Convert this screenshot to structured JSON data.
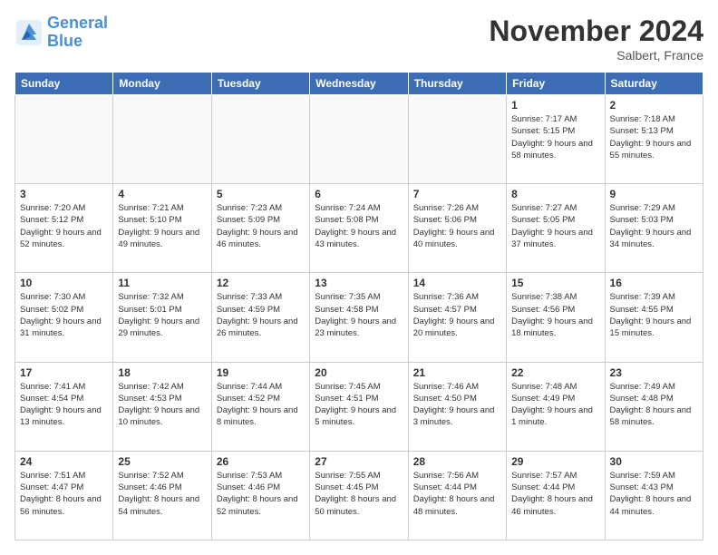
{
  "logo": {
    "line1": "General",
    "line2": "Blue"
  },
  "title": "November 2024",
  "location": "Salbert, France",
  "days_header": [
    "Sunday",
    "Monday",
    "Tuesday",
    "Wednesday",
    "Thursday",
    "Friday",
    "Saturday"
  ],
  "weeks": [
    [
      {
        "day": "",
        "info": ""
      },
      {
        "day": "",
        "info": ""
      },
      {
        "day": "",
        "info": ""
      },
      {
        "day": "",
        "info": ""
      },
      {
        "day": "",
        "info": ""
      },
      {
        "day": "1",
        "info": "Sunrise: 7:17 AM\nSunset: 5:15 PM\nDaylight: 9 hours and 58 minutes."
      },
      {
        "day": "2",
        "info": "Sunrise: 7:18 AM\nSunset: 5:13 PM\nDaylight: 9 hours and 55 minutes."
      }
    ],
    [
      {
        "day": "3",
        "info": "Sunrise: 7:20 AM\nSunset: 5:12 PM\nDaylight: 9 hours and 52 minutes."
      },
      {
        "day": "4",
        "info": "Sunrise: 7:21 AM\nSunset: 5:10 PM\nDaylight: 9 hours and 49 minutes."
      },
      {
        "day": "5",
        "info": "Sunrise: 7:23 AM\nSunset: 5:09 PM\nDaylight: 9 hours and 46 minutes."
      },
      {
        "day": "6",
        "info": "Sunrise: 7:24 AM\nSunset: 5:08 PM\nDaylight: 9 hours and 43 minutes."
      },
      {
        "day": "7",
        "info": "Sunrise: 7:26 AM\nSunset: 5:06 PM\nDaylight: 9 hours and 40 minutes."
      },
      {
        "day": "8",
        "info": "Sunrise: 7:27 AM\nSunset: 5:05 PM\nDaylight: 9 hours and 37 minutes."
      },
      {
        "day": "9",
        "info": "Sunrise: 7:29 AM\nSunset: 5:03 PM\nDaylight: 9 hours and 34 minutes."
      }
    ],
    [
      {
        "day": "10",
        "info": "Sunrise: 7:30 AM\nSunset: 5:02 PM\nDaylight: 9 hours and 31 minutes."
      },
      {
        "day": "11",
        "info": "Sunrise: 7:32 AM\nSunset: 5:01 PM\nDaylight: 9 hours and 29 minutes."
      },
      {
        "day": "12",
        "info": "Sunrise: 7:33 AM\nSunset: 4:59 PM\nDaylight: 9 hours and 26 minutes."
      },
      {
        "day": "13",
        "info": "Sunrise: 7:35 AM\nSunset: 4:58 PM\nDaylight: 9 hours and 23 minutes."
      },
      {
        "day": "14",
        "info": "Sunrise: 7:36 AM\nSunset: 4:57 PM\nDaylight: 9 hours and 20 minutes."
      },
      {
        "day": "15",
        "info": "Sunrise: 7:38 AM\nSunset: 4:56 PM\nDaylight: 9 hours and 18 minutes."
      },
      {
        "day": "16",
        "info": "Sunrise: 7:39 AM\nSunset: 4:55 PM\nDaylight: 9 hours and 15 minutes."
      }
    ],
    [
      {
        "day": "17",
        "info": "Sunrise: 7:41 AM\nSunset: 4:54 PM\nDaylight: 9 hours and 13 minutes."
      },
      {
        "day": "18",
        "info": "Sunrise: 7:42 AM\nSunset: 4:53 PM\nDaylight: 9 hours and 10 minutes."
      },
      {
        "day": "19",
        "info": "Sunrise: 7:44 AM\nSunset: 4:52 PM\nDaylight: 9 hours and 8 minutes."
      },
      {
        "day": "20",
        "info": "Sunrise: 7:45 AM\nSunset: 4:51 PM\nDaylight: 9 hours and 5 minutes."
      },
      {
        "day": "21",
        "info": "Sunrise: 7:46 AM\nSunset: 4:50 PM\nDaylight: 9 hours and 3 minutes."
      },
      {
        "day": "22",
        "info": "Sunrise: 7:48 AM\nSunset: 4:49 PM\nDaylight: 9 hours and 1 minute."
      },
      {
        "day": "23",
        "info": "Sunrise: 7:49 AM\nSunset: 4:48 PM\nDaylight: 8 hours and 58 minutes."
      }
    ],
    [
      {
        "day": "24",
        "info": "Sunrise: 7:51 AM\nSunset: 4:47 PM\nDaylight: 8 hours and 56 minutes."
      },
      {
        "day": "25",
        "info": "Sunrise: 7:52 AM\nSunset: 4:46 PM\nDaylight: 8 hours and 54 minutes."
      },
      {
        "day": "26",
        "info": "Sunrise: 7:53 AM\nSunset: 4:46 PM\nDaylight: 8 hours and 52 minutes."
      },
      {
        "day": "27",
        "info": "Sunrise: 7:55 AM\nSunset: 4:45 PM\nDaylight: 8 hours and 50 minutes."
      },
      {
        "day": "28",
        "info": "Sunrise: 7:56 AM\nSunset: 4:44 PM\nDaylight: 8 hours and 48 minutes."
      },
      {
        "day": "29",
        "info": "Sunrise: 7:57 AM\nSunset: 4:44 PM\nDaylight: 8 hours and 46 minutes."
      },
      {
        "day": "30",
        "info": "Sunrise: 7:59 AM\nSunset: 4:43 PM\nDaylight: 8 hours and 44 minutes."
      }
    ]
  ]
}
